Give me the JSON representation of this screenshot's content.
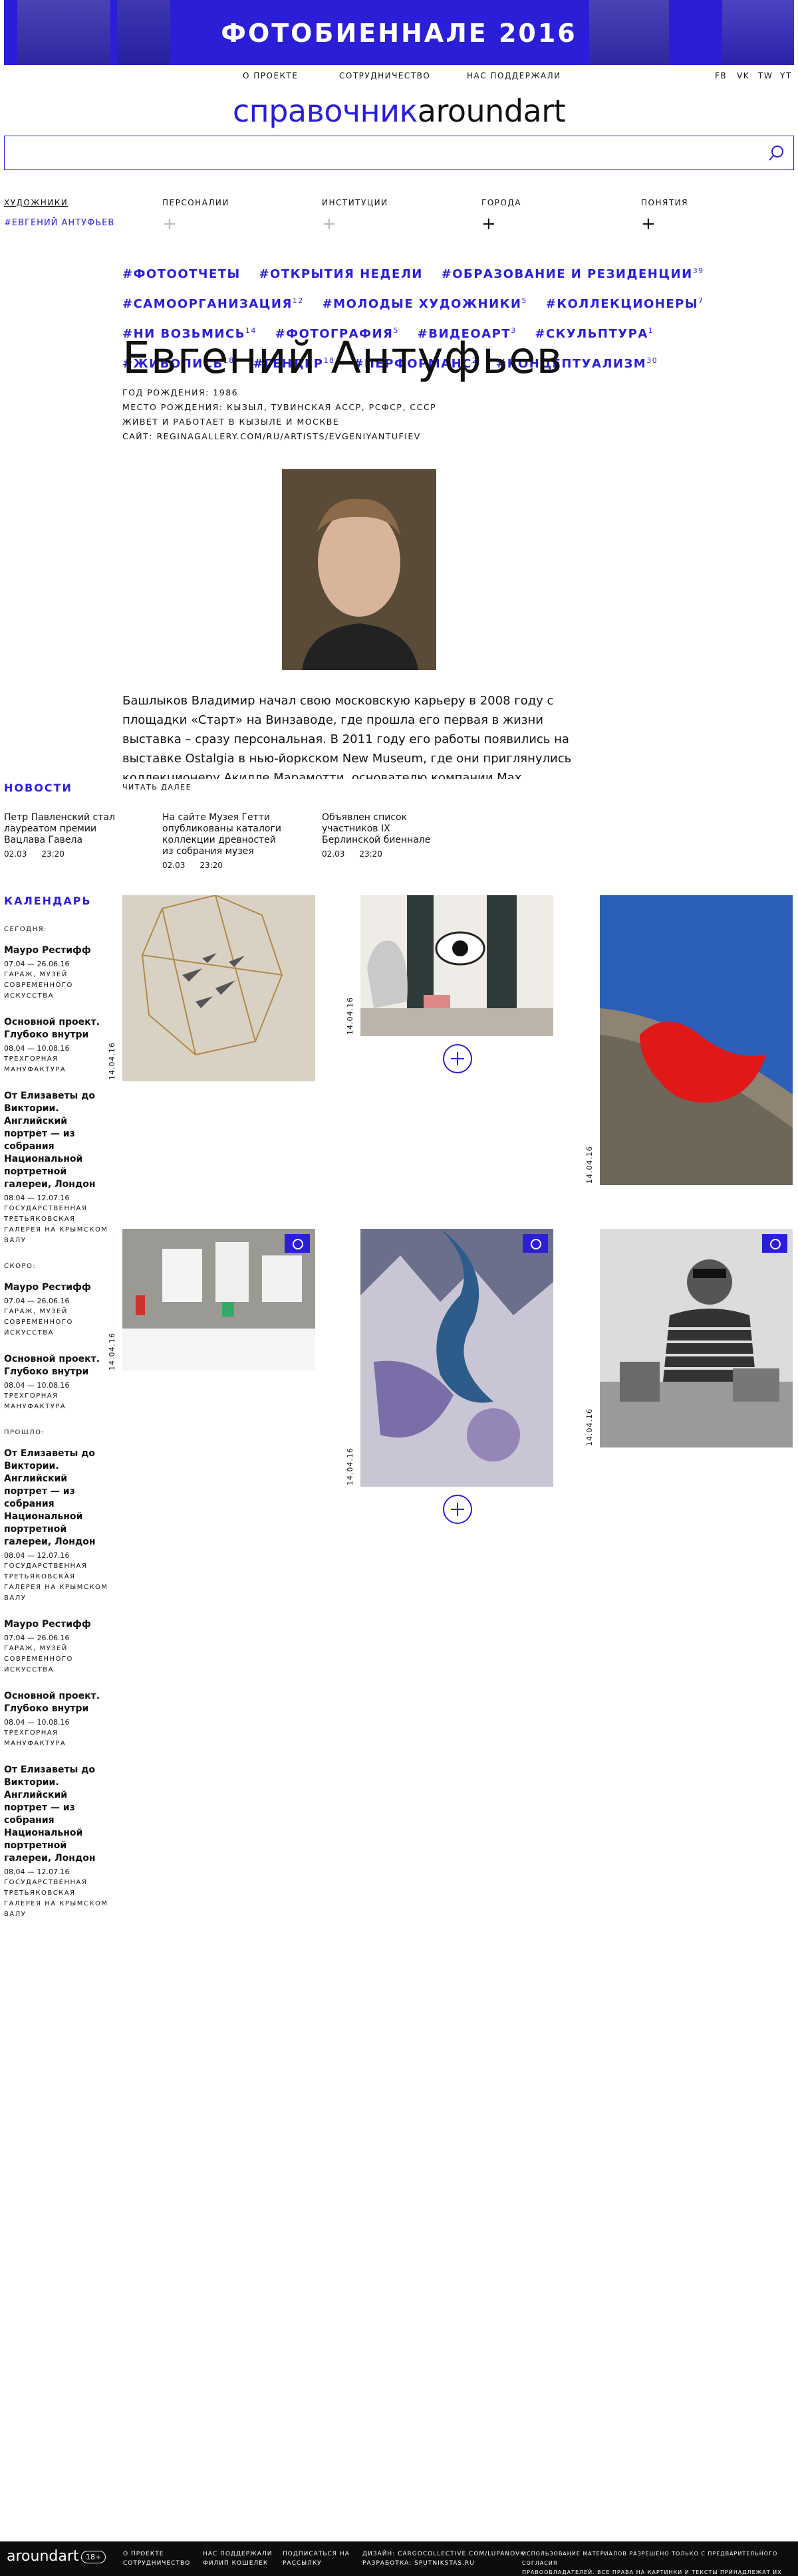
{
  "banner": {
    "title": "ФОТОБИЕННАЛЕ 2016"
  },
  "topnav": {
    "about": "О ПРОЕКТЕ",
    "cooperation": "СОТРУДНИЧЕСТВО",
    "supported": "НАС ПОДДЕРЖАЛИ",
    "social": [
      "FB",
      "VK",
      "TW",
      "YT"
    ]
  },
  "logo": {
    "part1": "справочник",
    "part2": "aroundart"
  },
  "search": {
    "placeholder": ""
  },
  "categories": {
    "items": [
      "ХУДОЖНИКИ",
      "ПЕРСОНАЛИИ",
      "ИНСТИТУЦИИ",
      "ГОРОДА",
      "ПОНЯТИЯ"
    ],
    "selected": "#ЕВГЕНИЙ АНТУФЬЕВ"
  },
  "tags": [
    {
      "label": "#ФОТООТЧЕТЫ",
      "count": ""
    },
    {
      "label": "#ОТКРЫТИЯ НЕДЕЛИ",
      "count": ""
    },
    {
      "label": "#ОБРАЗОВАНИЕ И РЕЗИДЕНЦИИ",
      "count": "39"
    },
    {
      "label": "#САМООРГАНИЗАЦИЯ",
      "count": "12"
    },
    {
      "label": "#МОЛОДЫЕ ХУДОЖНИКИ",
      "count": "5"
    },
    {
      "label": "#КОЛЛЕКЦИОНЕРЫ",
      "count": "7"
    },
    {
      "label": "#НИ ВОЗЬМИСЬ",
      "count": "14"
    },
    {
      "label": "#ФОТОГРАФИЯ",
      "count": "5"
    },
    {
      "label": "#ВИДЕОАРТ",
      "count": "3"
    },
    {
      "label": "#СКУЛЬПТУРА",
      "count": "1"
    },
    {
      "label": "#ЖИВОПИСЬ",
      "count": "18"
    },
    {
      "label": "#ГЕНДЕР",
      "count": "18"
    },
    {
      "label": "#ПЕРФОРМАНС",
      "count": "2"
    },
    {
      "label": "#КОНЦЕПТУАЛИЗМ",
      "count": "30"
    }
  ],
  "artist": {
    "name": "Евгений Антуфьев",
    "birth_year": "ГОД РОЖДЕНИЯ: 1986",
    "birth_place": "МЕСТО РОЖДЕНИЯ: КЫЗЫЛ, ТУВИНСКАЯ АССР, РСФСР, СССР",
    "lives": "ЖИВЕТ И РАБОТАЕТ В КЫЗЫЛЕ И МОСКВЕ",
    "site": "САЙТ: REGINAGALLERY.COM/RU/ARTISTS/EVGENIYANTUFIEV",
    "bio": "Башлыков Владимир начал свою московскую карьеру в 2008 году с площадки «Старт» на Винзаводе, где прошла его первая в жизни выставка – сразу персональная. В 2011 году его работы появились на выставке Ostalgia в нью-йоркском New Museum, где они приглянулись коллекционеру Акилле Марамотти, основателю компании Max",
    "read_more": "ЧИТАТЬ ДАЛЕЕ"
  },
  "news": {
    "heading": "НОВОСТИ",
    "items": [
      {
        "text": "Петр Павленский стал лауреатом премии Вацлава Гавела",
        "date": "02.03",
        "time": "23:20"
      },
      {
        "text": "На сайте Музея Гетти опубликованы каталоги коллекции древностей из собрания музея",
        "date": "02.03",
        "time": "23:20"
      },
      {
        "text": "Объявлен список участников IX Берлинской биеннале",
        "date": "02.03",
        "time": "23:20"
      }
    ]
  },
  "calendar": {
    "heading": "КАЛЕНДАРЬ",
    "today_label": "СЕГОДНЯ:",
    "soon_label": "СКОРО:",
    "past_label": "ПРОШЛО:",
    "today": [
      {
        "title": "Мауро Рестифф",
        "dates": "07.04 — 26.06.16",
        "place": "ГАРАЖ, МУЗЕЙ СОВРЕМЕННОГО ИСКУССТВА"
      },
      {
        "title": "Основной проект. Глубоко внутри",
        "dates": "08.04 — 10.08.16",
        "place": "ТРЕХГОРНАЯ МАНУФАКТУРА"
      },
      {
        "title": "От Елизаветы до Виктории. Английский портрет — из собрания Национальной портретной галереи, Лондон",
        "dates": "08.04 — 12.07.16",
        "place": "ГОСУДАРСТВЕННАЯ ТРЕТЬЯКОВСКАЯ ГАЛЕРЕЯ НА КРЫМСКОМ ВАЛУ"
      }
    ],
    "soon": [
      {
        "title": "Мауро Рестифф",
        "dates": "07.04 — 26.06.16",
        "place": "ГАРАЖ, МУЗЕЙ СОВРЕМЕННОГО ИСКУССТВА"
      },
      {
        "title": "Основной проект. Глубоко внутри",
        "dates": "08.04 — 10.08.16",
        "place": "ТРЕХГОРНАЯ МАНУФАКТУРА"
      }
    ],
    "past": [
      {
        "title": "От Елизаветы до Виктории. Английский портрет — из собрания Национальной портретной галереи, Лондон",
        "dates": "08.04 — 12.07.16",
        "place": "ГОСУДАРСТВЕННАЯ ТРЕТЬЯКОВСКАЯ ГАЛЕРЕЯ НА КРЫМСКОМ ВАЛУ"
      },
      {
        "title": "Мауро Рестифф",
        "dates": "07.04 — 26.06.16",
        "place": "ГАРАЖ, МУЗЕЙ СОВРЕМЕННОГО ИСКУССТВА"
      },
      {
        "title": "Основной проект. Глубоко внутри",
        "dates": "08.04 — 10.08.16",
        "place": "ТРЕХГОРНАЯ МАНУФАКТУРА"
      },
      {
        "title": "От Елизаветы до Виктории. Английский портрет — из собрания Национальной портретной галереи, Лондон",
        "dates": "08.04 — 12.07.16",
        "place": "ГОСУДАРСТВЕННАЯ ТРЕТЬЯКОВСКАЯ ГАЛЕРЕЯ НА КРЫМСКОМ ВАЛУ"
      }
    ],
    "tile_date": "14.04.16"
  },
  "footer": {
    "logo": "aroundart",
    "age": "18+",
    "col1": [
      "О ПРОЕКТЕ",
      "СОТРУДНИЧЕСТВО"
    ],
    "col2": [
      "НАС ПОДДЕРЖАЛИ",
      "ФИЛИП КОШЕЛЕК"
    ],
    "col3": [
      "ПОДПИСАТЬСЯ НА",
      "РАССЫЛКУ"
    ],
    "col4": [
      "ДИЗАЙН: CARGOCOLLECTIVE.COM/LUPANOVK",
      "РАЗРАБОТКА: SPUTNIKSTAS.RU"
    ],
    "col5": [
      "ИСПОЛЬЗОВАНИЕ МАТЕРИАЛОВ РАЗРЕШЕНО ТОЛЬКО С ПРЕДВАРИТЕЛЬНОГО СОГЛАСИЯ",
      "ПРАВООБЛАДАТЕЛЕЙ. ВСЕ ПРАВА НА КАРТИНКИ И ТЕКСТЫ ПРИНАДЛЕЖАТ ИХ АВТОРАМ."
    ]
  },
  "colors": {
    "accent": "#2a1fd6",
    "footer_bg": "#0d0d0d"
  }
}
